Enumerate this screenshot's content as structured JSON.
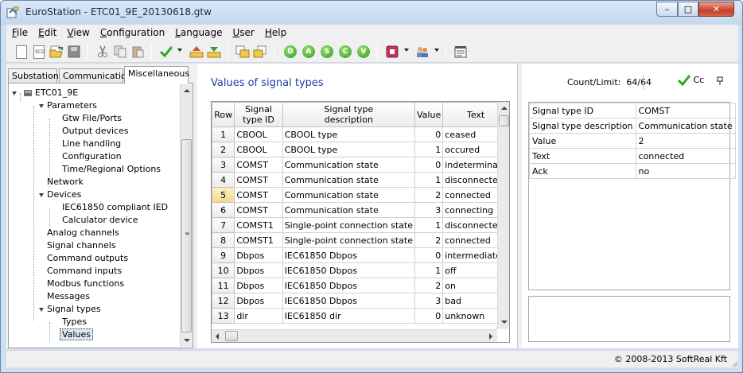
{
  "window": {
    "title": "EuroStation - ETC01_9E_20130618.gtw",
    "minimize": "–",
    "maximize": "□",
    "close": "✕"
  },
  "menu": [
    "File",
    "Edit",
    "View",
    "Configuration",
    "Language",
    "User",
    "Help"
  ],
  "menu_underline": [
    "F",
    "E",
    "V",
    "C",
    "L",
    "U",
    "H"
  ],
  "toolbar": {
    "icons": [
      "new-file-icon",
      "open-scd-icon",
      "open-folder-icon",
      "save-icon",
      "cut-icon",
      "copy-icon",
      "paste-icon",
      "check-icon",
      "upload-icon",
      "download-icon",
      "import-icon",
      "export-icon",
      "d-icon",
      "a-icon",
      "s-icon",
      "c-icon",
      "v-icon",
      "stop-icon",
      "users-icon",
      "properties-icon"
    ],
    "circle_letters": [
      "D",
      "A",
      "S",
      "C",
      "V"
    ]
  },
  "tabs": [
    "Substation",
    "Communication",
    "Miscellaneous"
  ],
  "active_tab": "Miscellaneous",
  "tree": {
    "root": "ETC01_9E",
    "items": [
      {
        "label": "Parameters"
      },
      {
        "label": "Gtw File/Ports"
      },
      {
        "label": "Output devices"
      },
      {
        "label": "Line handling"
      },
      {
        "label": "Configuration"
      },
      {
        "label": "Time/Regional Options"
      },
      {
        "label": "Network"
      },
      {
        "label": "Devices"
      },
      {
        "label": "IEC61850 compliant IED"
      },
      {
        "label": "Calculator device"
      },
      {
        "label": "Analog channels"
      },
      {
        "label": "Signal channels"
      },
      {
        "label": "Command outputs"
      },
      {
        "label": "Command inputs"
      },
      {
        "label": "Modbus functions"
      },
      {
        "label": "Messages"
      },
      {
        "label": "Signal types"
      },
      {
        "label": "Types"
      },
      {
        "label": "Values"
      }
    ],
    "selected": "Values"
  },
  "center": {
    "title": "Values of signal types",
    "columns": [
      "Row",
      "Signal type ID",
      "Signal type description",
      "Value",
      "Text"
    ],
    "rows": [
      [
        "1",
        "CBOOL",
        "CBOOL type",
        "0",
        "ceased"
      ],
      [
        "2",
        "CBOOL",
        "CBOOL type",
        "1",
        "occured"
      ],
      [
        "3",
        "COMST",
        "Communication state",
        "0",
        "indeterminate"
      ],
      [
        "4",
        "COMST",
        "Communication state",
        "1",
        "disconnected"
      ],
      [
        "5",
        "COMST",
        "Communication state",
        "2",
        "connected"
      ],
      [
        "6",
        "COMST",
        "Communication state",
        "3",
        "connecting"
      ],
      [
        "7",
        "COMST1",
        "Single-point connection state",
        "1",
        "disconnected"
      ],
      [
        "8",
        "COMST1",
        "Single-point connection state",
        "2",
        "connected"
      ],
      [
        "9",
        "Dbpos",
        "IEC61850 Dbpos",
        "0",
        "intermediate"
      ],
      [
        "10",
        "Dbpos",
        "IEC61850 Dbpos",
        "1",
        "off"
      ],
      [
        "11",
        "Dbpos",
        "IEC61850 Dbpos",
        "2",
        "on"
      ],
      [
        "12",
        "Dbpos",
        "IEC61850 Dbpos",
        "3",
        "bad"
      ],
      [
        "13",
        "dir",
        "IEC61850 dir",
        "0",
        "unknown"
      ]
    ],
    "selected_row": "5"
  },
  "right": {
    "count_label": "Count/Limit:",
    "count_value": "64/64",
    "check_label": "Cc",
    "props": [
      [
        "Signal type ID",
        "COMST"
      ],
      [
        "Signal type description",
        "Communication state"
      ],
      [
        "Value",
        "2"
      ],
      [
        "Text",
        "connected"
      ],
      [
        "Ack",
        "no"
      ]
    ]
  },
  "status": "© 2008-2013 SoftReal Kft"
}
